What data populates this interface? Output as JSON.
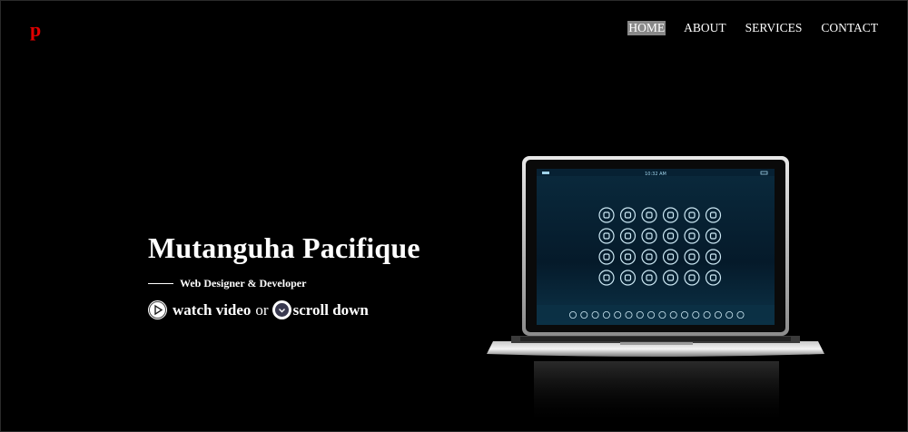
{
  "brand": {
    "logo_text": "p",
    "logo_color": "#e00000"
  },
  "nav": {
    "items": [
      {
        "label": "HOME",
        "active": true
      },
      {
        "label": "ABOUT",
        "active": false
      },
      {
        "label": "SERVICES",
        "active": false
      },
      {
        "label": "CONTACT",
        "active": false
      }
    ]
  },
  "hero": {
    "name": "Mutanguha Pacifique",
    "subtitle": "Web Designer & Developer",
    "watch_label": "watch video",
    "or_text": "or",
    "scroll_label": "scroll down"
  },
  "laptop_screen": {
    "time": "10:32 AM"
  }
}
